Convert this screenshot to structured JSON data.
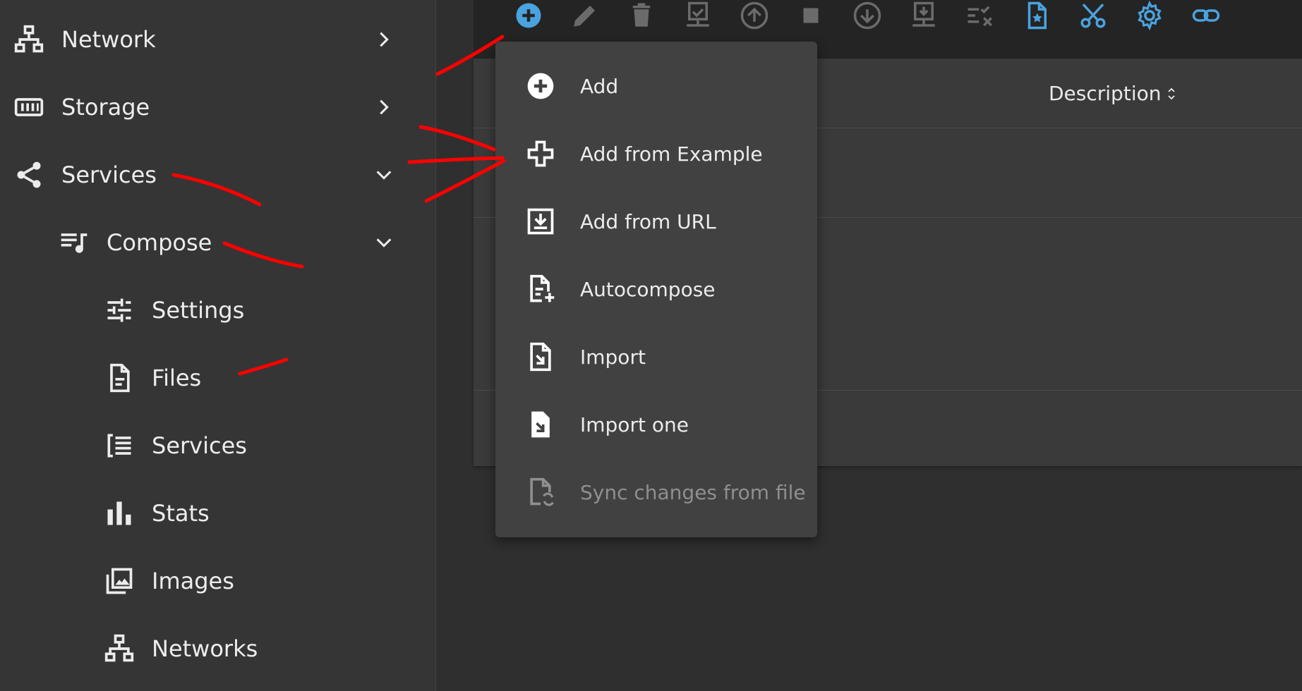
{
  "sidebar": {
    "items": [
      {
        "label": "Network",
        "icon": "network-icon",
        "chevron": "right"
      },
      {
        "label": "Storage",
        "icon": "storage-icon",
        "chevron": "right"
      },
      {
        "label": "Services",
        "icon": "share-icon",
        "chevron": "down"
      },
      {
        "label": "Compose",
        "icon": "compose-icon",
        "chevron": "down"
      },
      {
        "label": "Settings",
        "icon": "tune-icon"
      },
      {
        "label": "Files",
        "icon": "file-document-icon"
      },
      {
        "label": "Services",
        "icon": "format-list-icon"
      },
      {
        "label": "Stats",
        "icon": "bar-chart-icon"
      },
      {
        "label": "Images",
        "icon": "image-multiple-icon"
      },
      {
        "label": "Networks",
        "icon": "network-icon"
      }
    ]
  },
  "toolbar": {
    "buttons": [
      {
        "name": "add-icon",
        "color": "#4aa3df",
        "active": true
      },
      {
        "name": "pencil-icon",
        "color": "#6b6b6b",
        "active": false
      },
      {
        "name": "trash-icon",
        "color": "#6b6b6b",
        "active": false
      },
      {
        "name": "server-check-icon",
        "color": "#6b6b6b",
        "active": false
      },
      {
        "name": "arrow-up-circle-icon",
        "color": "#6b6b6b",
        "active": false
      },
      {
        "name": "stop-icon",
        "color": "#6b6b6b",
        "active": false
      },
      {
        "name": "arrow-down-circle-icon",
        "color": "#6b6b6b",
        "active": false
      },
      {
        "name": "server-download-icon",
        "color": "#6b6b6b",
        "active": false
      },
      {
        "name": "list-check-x-icon",
        "color": "#6b6b6b",
        "active": false
      },
      {
        "name": "file-star-icon",
        "color": "#4aa3df",
        "active": true
      },
      {
        "name": "scissors-icon",
        "color": "#4aa3df",
        "active": true
      },
      {
        "name": "gear-icon",
        "color": "#4aa3df",
        "active": true
      },
      {
        "name": "link-icon",
        "color": "#4aa3df",
        "active": true
      }
    ]
  },
  "table": {
    "column_description": "Description"
  },
  "menu": {
    "items": [
      {
        "label": "Add",
        "icon": "plus-circle-icon",
        "enabled": true
      },
      {
        "label": "Add from Example",
        "icon": "plus-outline-icon",
        "enabled": true
      },
      {
        "label": "Add from URL",
        "icon": "download-box-icon",
        "enabled": true
      },
      {
        "label": "Autocompose",
        "icon": "file-plus-icon",
        "enabled": true
      },
      {
        "label": "Import",
        "icon": "file-import-icon",
        "enabled": true
      },
      {
        "label": "Import one",
        "icon": "file-import-solid-icon",
        "enabled": true
      },
      {
        "label": "Sync changes from file",
        "icon": "file-sync-icon",
        "enabled": false
      }
    ]
  },
  "colors": {
    "accent": "#4aa3df",
    "annotation": "#ff0000",
    "sidebar_bg": "#353535",
    "menu_bg": "#414141"
  }
}
